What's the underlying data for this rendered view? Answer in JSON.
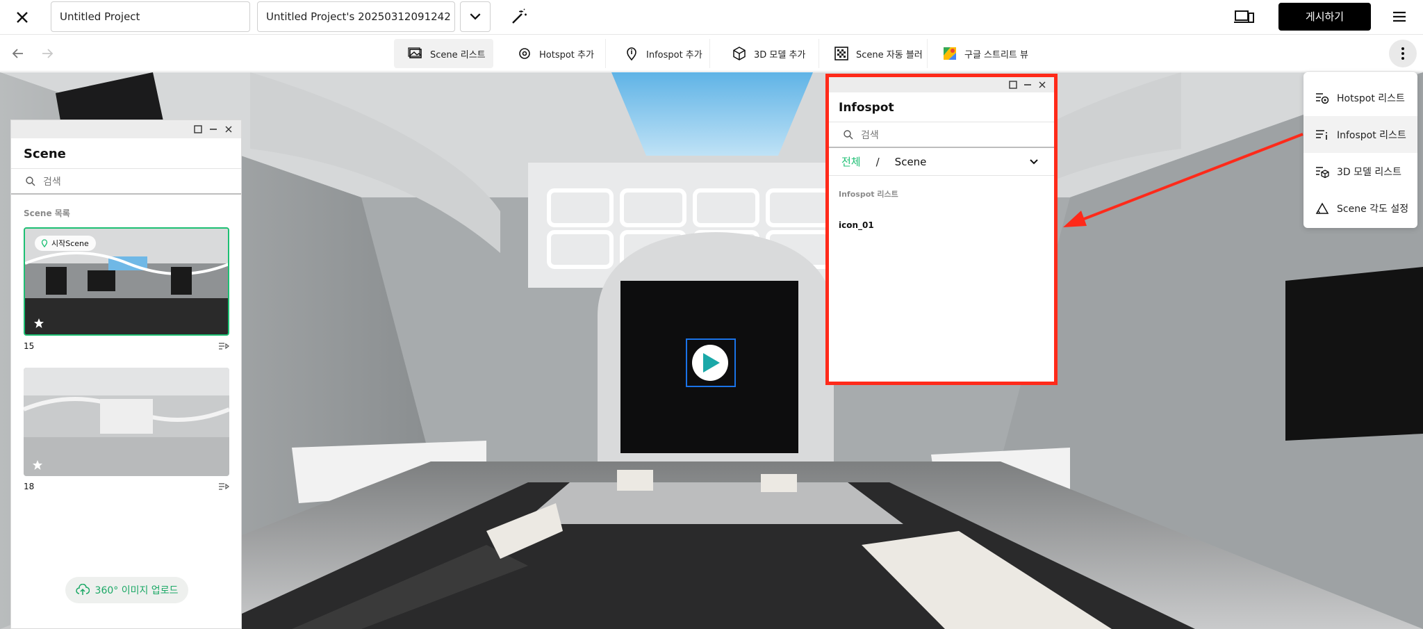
{
  "topbar": {
    "project_name": "Untitled Project",
    "version_name": "Untitled Project's 20250312091242",
    "publish_label": "게시하기"
  },
  "toolbar": {
    "tools": [
      {
        "label": "Scene 리스트",
        "icon": "scene-list-icon"
      },
      {
        "label": "Hotspot 추가",
        "icon": "hotspot-add-icon"
      },
      {
        "label": "Infospot 추가",
        "icon": "infospot-add-icon"
      },
      {
        "label": "3D 모델 추가",
        "icon": "cube-icon"
      },
      {
        "label": "Scene 자동 블러",
        "icon": "blur-icon"
      },
      {
        "label": "구글 스트리트 뷰",
        "icon": "google-street-view-icon"
      }
    ]
  },
  "scene_panel": {
    "title": "Scene",
    "search_placeholder": "검색",
    "section_label": "Scene 목록",
    "scenes": [
      {
        "number": "15",
        "badge": "시작Scene",
        "selected": true
      },
      {
        "number": "18",
        "badge": "",
        "selected": false
      }
    ],
    "upload_label": "360° 이미지 업로드"
  },
  "info_panel": {
    "title": "Infospot",
    "search_placeholder": "검색",
    "filter_all": "전체",
    "filter_sep": "/",
    "filter_scene": "Scene",
    "list_label": "Infospot 리스트",
    "items": [
      "icon_01"
    ]
  },
  "menu": {
    "items": [
      {
        "label": "Hotspot 리스트",
        "icon": "hotspot-list-icon"
      },
      {
        "label": "Infospot 리스트",
        "icon": "infospot-list-icon"
      },
      {
        "label": "3D 모델 리스트",
        "icon": "model-list-icon"
      },
      {
        "label": "Scene 각도 설정",
        "icon": "angle-icon"
      }
    ]
  },
  "colors": {
    "accent": "#1dbf73",
    "highlight": "#ff2a1a",
    "publish_bg": "#000000"
  }
}
